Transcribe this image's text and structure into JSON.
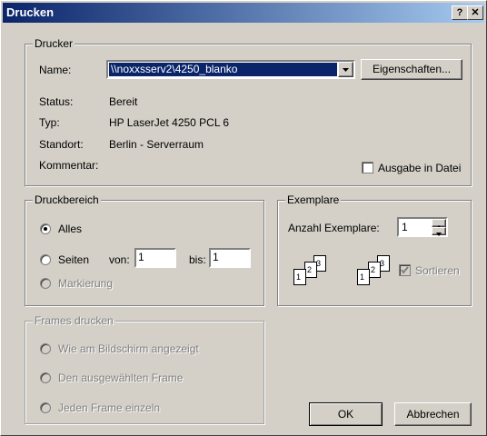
{
  "window": {
    "title": "Drucken",
    "help_glyph": "?",
    "close_glyph": "✕"
  },
  "printer": {
    "group_label": "Drucker",
    "name_label": "Name:",
    "name_value": "\\\\noxxsserv2\\4250_blanko",
    "properties_button": "Eigenschaften...",
    "status_label": "Status:",
    "status_value": "Bereit",
    "type_label": "Typ:",
    "type_value": "HP LaserJet 4250 PCL 6",
    "location_label": "Standort:",
    "location_value": "Berlin - Serverraum",
    "comment_label": "Kommentar:",
    "print_to_file_label": "Ausgabe in Datei"
  },
  "range": {
    "group_label": "Druckbereich",
    "all_label": "Alles",
    "pages_label": "Seiten",
    "from_label": "von:",
    "from_value": "1",
    "to_label": "bis:",
    "to_value": "1",
    "selection_label": "Markierung"
  },
  "copies": {
    "group_label": "Exemplare",
    "count_label": "Anzahl Exemplare:",
    "count_value": "1",
    "collate_label": "Sortieren",
    "page_numbers": [
      "1",
      "2",
      "3"
    ]
  },
  "frames": {
    "group_label": "Frames drucken",
    "option1": "Wie am Bildschirm angezeigt",
    "option2": "Den ausgewählten Frame",
    "option3": "Jeden Frame einzeln"
  },
  "buttons": {
    "ok": "OK",
    "cancel": "Abbrechen"
  }
}
